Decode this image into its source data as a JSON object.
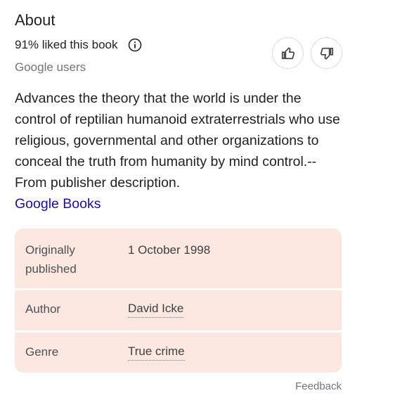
{
  "section": {
    "title": "About"
  },
  "rating": {
    "liked_text": "91% liked this book",
    "source": "Google users"
  },
  "votes": {
    "up_icon": "thumbs-up-icon",
    "down_icon": "thumbs-down-icon"
  },
  "description": {
    "text": "Advances the theory that the world is under the control of reptilian humanoid extraterrestrials who use religious, governmental and other organizations to conceal the truth from humanity by mind control.--From publisher description.",
    "source_link": "Google Books"
  },
  "details": {
    "published_label": "Originally published",
    "published_value": "1 October 1998",
    "author_label": "Author",
    "author_value": "David Icke",
    "genre_label": "Genre",
    "genre_value": "True crime"
  },
  "footer": {
    "feedback": "Feedback"
  },
  "colors": {
    "panel_bg": "#fce8e1",
    "link": "#1a0dab"
  }
}
